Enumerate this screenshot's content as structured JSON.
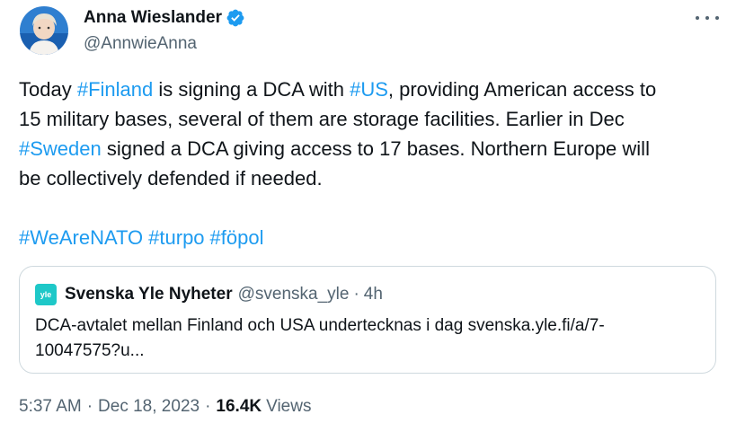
{
  "author": {
    "name": "Anna Wieslander",
    "handle": "@AnnwieAnna",
    "verified_color": "#1d9bf0"
  },
  "tweet": {
    "lines": [
      [
        {
          "t": "Today ",
          "tag": false
        },
        {
          "t": "#Finland",
          "tag": true
        },
        {
          "t": " is signing a DCA with ",
          "tag": false
        },
        {
          "t": "#US",
          "tag": true
        },
        {
          "t": ", providing American access to",
          "tag": false
        }
      ],
      [
        {
          "t": "15 military bases, several of them are storage facilities. Earlier in Dec",
          "tag": false
        }
      ],
      [
        {
          "t": "#Sweden",
          "tag": true
        },
        {
          "t": " signed a DCA giving access to 17 bases. Northern Europe will",
          "tag": false
        }
      ],
      [
        {
          "t": "be collectively defended if needed.",
          "tag": false
        }
      ]
    ],
    "hashtags": [
      "#WeAreNATO",
      "#turpo",
      "#föpol"
    ]
  },
  "quote": {
    "logo_text": "yle",
    "name": "Svenska Yle Nyheter",
    "handle": "@svenska_yle",
    "separator": "·",
    "time": "4h",
    "text_line1": "DCA-avtalet mellan Finland och USA undertecknas i dag svenska.yle.fi/a/7-",
    "text_line2": "10047575?u..."
  },
  "meta": {
    "time": "5:37 AM",
    "separator": "·",
    "date": "Dec 18, 2023",
    "views_count": "16.4K",
    "views_label": "Views"
  },
  "colors": {
    "link": "#1d9bf0",
    "secondary": "#536471",
    "primary": "#0f1419",
    "border": "#cfd9de"
  },
  "icons": {
    "more": "more-options-icon",
    "verified": "verified-badge-icon"
  }
}
